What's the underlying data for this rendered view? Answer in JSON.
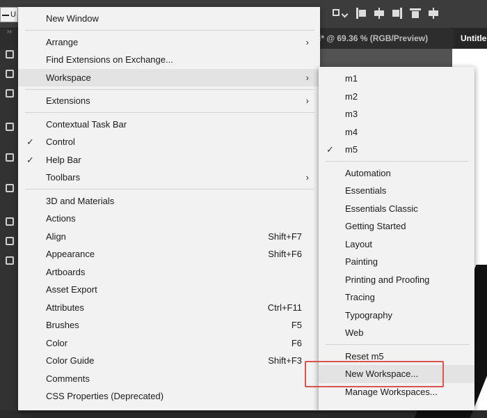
{
  "app": {
    "top_left_label": "U",
    "document_tab": "i* @ 69.36 % (RGB/Preview)",
    "document_tab_2": "Untitle",
    "collapse_glyph": "››"
  },
  "window_menu": {
    "items": [
      {
        "label": "New Window"
      },
      {
        "label": "Arrange",
        "submenu": true
      },
      {
        "label": "Find Extensions on Exchange..."
      },
      {
        "label": "Workspace",
        "submenu": true,
        "highlighted": true
      },
      {
        "label": "Extensions",
        "submenu": true
      },
      {
        "label": "Contextual Task Bar"
      },
      {
        "label": "Control",
        "checked": true
      },
      {
        "label": "Help Bar",
        "checked": true
      },
      {
        "label": "Toolbars",
        "submenu": true
      },
      {
        "label": "3D and Materials"
      },
      {
        "label": "Actions"
      },
      {
        "label": "Align",
        "shortcut": "Shift+F7"
      },
      {
        "label": "Appearance",
        "shortcut": "Shift+F6"
      },
      {
        "label": "Artboards"
      },
      {
        "label": "Asset Export"
      },
      {
        "label": "Attributes",
        "shortcut": "Ctrl+F11"
      },
      {
        "label": "Brushes",
        "shortcut": "F5"
      },
      {
        "label": "Color",
        "shortcut": "F6"
      },
      {
        "label": "Color Guide",
        "shortcut": "Shift+F3"
      },
      {
        "label": "Comments"
      },
      {
        "label": "CSS Properties (Deprecated)"
      }
    ],
    "check_glyph": "✓",
    "arrow_glyph": "›"
  },
  "workspace_menu": {
    "items": [
      {
        "label": "m1"
      },
      {
        "label": "m2"
      },
      {
        "label": "m3"
      },
      {
        "label": "m4"
      },
      {
        "label": "m5",
        "checked": true
      },
      {
        "label": "Automation"
      },
      {
        "label": "Essentials"
      },
      {
        "label": "Essentials Classic"
      },
      {
        "label": "Getting Started"
      },
      {
        "label": "Layout"
      },
      {
        "label": "Painting"
      },
      {
        "label": "Printing and Proofing"
      },
      {
        "label": "Tracing"
      },
      {
        "label": "Typography"
      },
      {
        "label": "Web"
      },
      {
        "label": "Reset m5"
      },
      {
        "label": "New Workspace...",
        "highlighted": true,
        "callout": true
      },
      {
        "label": "Manage Workspaces..."
      }
    ]
  },
  "colors": {
    "menu_bg": "#f2f2f2",
    "highlight": "#e3e3e3",
    "callout_border": "#d9534f",
    "app_bg": "#2b2b2b"
  }
}
